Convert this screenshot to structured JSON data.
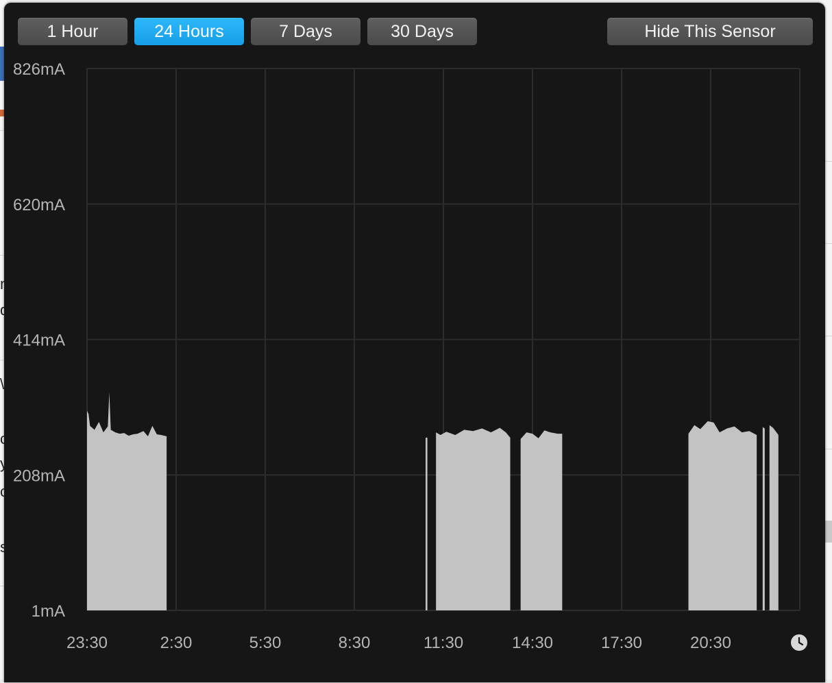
{
  "background_fragments": {
    "left_text": [
      "n",
      "d",
      "\\",
      "c",
      "y",
      "c",
      "s"
    ]
  },
  "range_tabs": [
    {
      "label": "1 Hour",
      "active": false
    },
    {
      "label": "24 Hours",
      "active": true
    },
    {
      "label": "7 Days",
      "active": false
    },
    {
      "label": "30 Days",
      "active": false
    }
  ],
  "hide_sensor_label": "Hide This Sensor",
  "colors": {
    "panel_bg": "#161616",
    "active_tab": "#1aa8f0",
    "area_fill": "#c3c3c3",
    "grid": "#2c2c2c",
    "label": "#b5b5b5"
  },
  "icons": {
    "time": "clock-icon"
  },
  "chart_data": {
    "type": "area",
    "y_ticks": [
      "826mA",
      "620mA",
      "414mA",
      "208mA",
      "1mA"
    ],
    "x_ticks": [
      "23:30",
      "2:30",
      "5:30",
      "8:30",
      "11:30",
      "14:30",
      "17:30",
      "20:30"
    ],
    "ylim_mA": [
      1,
      826
    ],
    "xlim_hours_since_23_30": [
      0,
      24
    ],
    "grid": true,
    "unit": "mA",
    "segments": [
      {
        "points": [
          [
            0.0,
            305
          ],
          [
            0.05,
            300
          ],
          [
            0.1,
            282
          ],
          [
            0.25,
            276
          ],
          [
            0.4,
            288
          ],
          [
            0.55,
            272
          ],
          [
            0.7,
            281
          ],
          [
            0.75,
            333
          ],
          [
            0.8,
            276
          ],
          [
            0.95,
            272
          ],
          [
            1.1,
            270
          ],
          [
            1.25,
            271
          ],
          [
            1.4,
            267
          ],
          [
            1.55,
            269
          ],
          [
            1.7,
            270
          ],
          [
            1.9,
            274
          ],
          [
            2.05,
            266
          ],
          [
            2.2,
            282
          ],
          [
            2.35,
            269
          ],
          [
            2.5,
            268
          ],
          [
            2.68,
            266
          ]
        ]
      },
      {
        "points": [
          [
            11.4,
            264
          ],
          [
            11.46,
            264
          ]
        ]
      },
      {
        "points": [
          [
            11.75,
            272
          ],
          [
            11.9,
            268
          ],
          [
            12.1,
            273
          ],
          [
            12.4,
            268
          ],
          [
            12.7,
            276
          ],
          [
            13.0,
            274
          ],
          [
            13.3,
            278
          ],
          [
            13.6,
            272
          ],
          [
            13.9,
            279
          ],
          [
            14.1,
            272
          ],
          [
            14.25,
            264
          ]
        ]
      },
      {
        "points": [
          [
            14.6,
            262
          ],
          [
            14.8,
            272
          ],
          [
            15.0,
            270
          ],
          [
            15.2,
            263
          ],
          [
            15.4,
            275
          ],
          [
            15.6,
            272
          ],
          [
            15.85,
            270
          ],
          [
            16.0,
            270
          ]
        ]
      },
      {
        "points": [
          [
            20.25,
            270
          ],
          [
            20.45,
            283
          ],
          [
            20.65,
            277
          ],
          [
            20.9,
            289
          ],
          [
            21.1,
            287
          ],
          [
            21.3,
            272
          ],
          [
            21.55,
            278
          ],
          [
            21.8,
            281
          ],
          [
            22.05,
            272
          ],
          [
            22.3,
            274
          ],
          [
            22.55,
            268
          ]
        ]
      },
      {
        "points": [
          [
            22.75,
            280
          ],
          [
            22.82,
            278
          ]
        ]
      },
      {
        "points": [
          [
            22.98,
            283
          ],
          [
            23.1,
            279
          ],
          [
            23.25,
            270
          ],
          [
            23.28,
            268
          ]
        ]
      }
    ]
  }
}
